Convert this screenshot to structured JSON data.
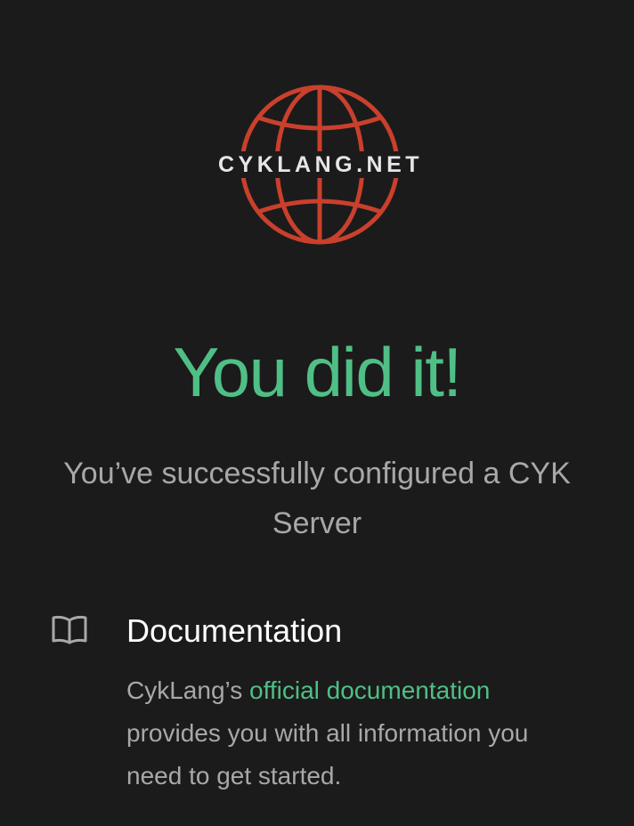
{
  "logo": {
    "text": "CYKLANG.NET",
    "globe_color": "#c9402c"
  },
  "hero": {
    "title": "You did it!",
    "subtitle": "You’ve successfully configured a CYK Server"
  },
  "documentation": {
    "icon": "book-icon",
    "title": "Documentation",
    "text_before": "CykLang’s ",
    "link_text": "official documentation",
    "text_after": " provides you with all information you need to get started."
  },
  "colors": {
    "background": "#1b1b1b",
    "accent": "#4fbf86",
    "muted_text": "#a8a8a8"
  }
}
